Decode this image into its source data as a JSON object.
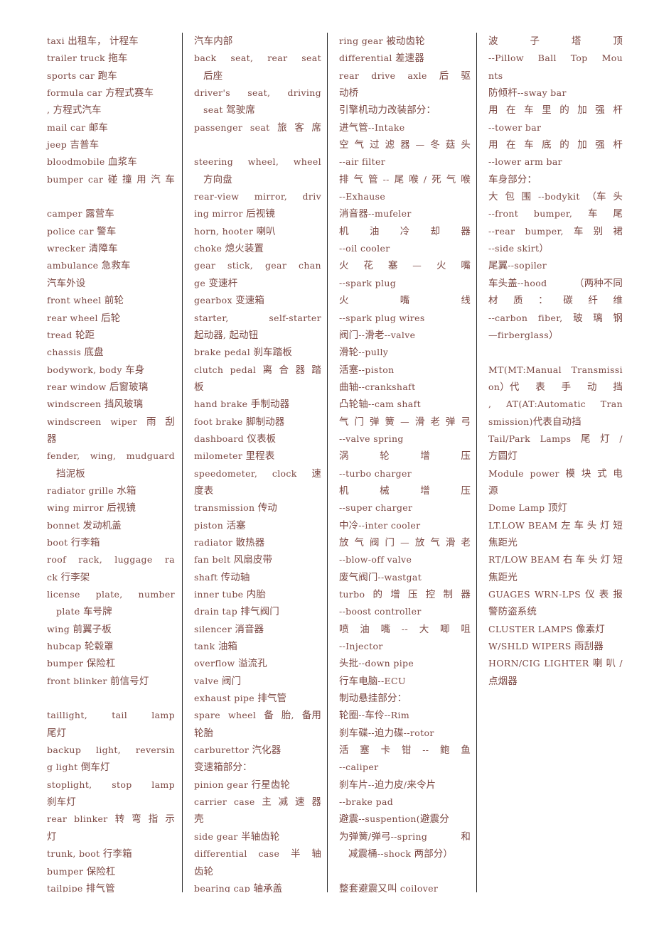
{
  "document": {
    "kind": "car-vocabulary-glossary",
    "language_pair": "English-Chinese",
    "text_color": "#7b4742",
    "rule_color": "#2b2b2b",
    "background": "#ffffff",
    "column_count": 4
  },
  "columns": [
    {
      "name": "column-1",
      "lines": [
        {
          "id": "c1l1",
          "text": "taxi  出租车， 计程车"
        },
        {
          "id": "c1l2",
          "text": "trailer  truck  拖车"
        },
        {
          "id": "c1l3",
          "text": "sports  car  跑车"
        },
        {
          "id": "c1l4",
          "text": "formula  car  方程式赛车"
        },
        {
          "id": "c1l5",
          "text": ",  方程式汽车"
        },
        {
          "id": "c1l6",
          "text": "mail  car  邮车"
        },
        {
          "id": "c1l7",
          "text": "jeep  吉普车"
        },
        {
          "id": "c1l8",
          "text": "bloodmobile  血浆车"
        },
        {
          "id": "c1l9",
          "text": "bumper  car  碰 撞 用 汽 车",
          "justify": true
        },
        {
          "id": "c1l10",
          "text": "",
          "blank": true
        },
        {
          "id": "c1l11",
          "text": "camper  露营车"
        },
        {
          "id": "c1l12",
          "text": "police  car  警车"
        },
        {
          "id": "c1l13",
          "text": "wrecker  清障车"
        },
        {
          "id": "c1l14",
          "text": "ambulance  急救车"
        },
        {
          "id": "c1l15",
          "text": "汽车外设"
        },
        {
          "id": "c1l16",
          "text": "front  wheel  前轮"
        },
        {
          "id": "c1l17",
          "text": "rear  wheel  后轮"
        },
        {
          "id": "c1l18",
          "text": "tread  轮距"
        },
        {
          "id": "c1l19",
          "text": "chassis  底盘"
        },
        {
          "id": "c1l20",
          "text": "bodywork,  body 车身"
        },
        {
          "id": "c1l21",
          "text": "rear  window  后窗玻璃"
        },
        {
          "id": "c1l22",
          "text": "windscreen  挡风玻璃"
        },
        {
          "id": "c1l23",
          "text": "windscreen  wiper  雨  刮",
          "justify": true
        },
        {
          "id": "c1l24",
          "text": "器"
        },
        {
          "id": "c1l25",
          "text": "fender,  wing,  mudguard",
          "justify": true
        },
        {
          "id": "c1l26",
          "text": "挡泥板",
          "indent": true
        },
        {
          "id": "c1l27",
          "text": "radiator  grille  水箱"
        },
        {
          "id": "c1l28",
          "text": "wing  mirror  后视镜"
        },
        {
          "id": "c1l29",
          "text": "bonnet  发动机盖"
        },
        {
          "id": "c1l30",
          "text": "boot  行李箱"
        },
        {
          "id": "c1l31",
          "text": "roof  rack,  luggage  ra",
          "justify": true
        },
        {
          "id": "c1l32",
          "text": "ck  行李架"
        },
        {
          "id": "c1l33",
          "text": "license  plate,  number",
          "justify": true
        },
        {
          "id": "c1l34",
          "text": "plate  车号牌",
          "indent": true
        },
        {
          "id": "c1l35",
          "text": "wing  前翼子板"
        },
        {
          "id": "c1l36",
          "text": "hubcap  轮毂罩"
        },
        {
          "id": "c1l37",
          "text": "bumper  保险杠"
        },
        {
          "id": "c1l38",
          "text": "front  blinker  前信号灯"
        },
        {
          "id": "c1l39",
          "text": "",
          "blank": true
        },
        {
          "id": "c1l40",
          "text": "taillight,  tail  lamp",
          "justify": true
        },
        {
          "id": "c1l41",
          "text": "尾灯"
        },
        {
          "id": "c1l42",
          "text": "backup  light,  reversin",
          "justify": true
        },
        {
          "id": "c1l43",
          "text": "g  light  倒车灯"
        },
        {
          "id": "c1l44",
          "text": "stoplight,  stop  lamp",
          "justify": true
        },
        {
          "id": "c1l45",
          "text": "刹车灯"
        },
        {
          "id": "c1l46",
          "text": "rear  blinker  转 弯 指 示",
          "justify": true
        },
        {
          "id": "c1l47",
          "text": "灯"
        },
        {
          "id": "c1l48",
          "text": "trunk,  boot  行李箱"
        },
        {
          "id": "c1l49",
          "text": "bumper  保险杠"
        },
        {
          "id": "c1l50",
          "text": "tailpipe  排气管"
        }
      ]
    },
    {
      "name": "column-2",
      "lines": [
        {
          "id": "c2l1",
          "text": "汽车内部"
        },
        {
          "id": "c2l2",
          "text": "back  seat,  rear  seat",
          "justify": true
        },
        {
          "id": "c2l3",
          "text": "后座",
          "indent": true
        },
        {
          "id": "c2l4",
          "text": "driver's  seat,  driving",
          "justify": true
        },
        {
          "id": "c2l5",
          "text": "seat  驾驶席",
          "indent": true
        },
        {
          "id": "c2l6",
          "text": "passenger  seat  旅 客 席",
          "justify": true
        },
        {
          "id": "c2l7",
          "text": "",
          "blank": true
        },
        {
          "id": "c2l8",
          "text": "steering  wheel,  wheel",
          "justify": true
        },
        {
          "id": "c2l9",
          "text": "方向盘",
          "indent": true
        },
        {
          "id": "c2l10",
          "text": "rear-view  mirror,  driv",
          "justify": true
        },
        {
          "id": "c2l11",
          "text": "ing  mirror  后视镜"
        },
        {
          "id": "c2l12",
          "text": "horn,  hooter  喇叭"
        },
        {
          "id": "c2l13",
          "text": "choke  熄火装置"
        },
        {
          "id": "c2l14",
          "text": "gear  stick,  gear  chan",
          "justify": true
        },
        {
          "id": "c2l15",
          "text": "ge  变速杆"
        },
        {
          "id": "c2l16",
          "text": "gearbox  变速箱"
        },
        {
          "id": "c2l17",
          "text": "starter,  self-starter",
          "justify": true
        },
        {
          "id": "c2l18",
          "text": "起动器, 起动钮"
        },
        {
          "id": "c2l19",
          "text": "brake  pedal  刹车踏板"
        },
        {
          "id": "c2l20",
          "text": "clutch  pedal  离 合 器 踏",
          "justify": true
        },
        {
          "id": "c2l21",
          "text": "板"
        },
        {
          "id": "c2l22",
          "text": "hand  brake  手制动器"
        },
        {
          "id": "c2l23",
          "text": "foot  brake  脚制动器"
        },
        {
          "id": "c2l24",
          "text": "dashboard  仪表板"
        },
        {
          "id": "c2l25",
          "text": "milometer  里程表"
        },
        {
          "id": "c2l26",
          "text": "speedometer,  clock  速",
          "justify": true
        },
        {
          "id": "c2l27",
          "text": "度表"
        },
        {
          "id": "c2l28",
          "text": "transmission  传动"
        },
        {
          "id": "c2l29",
          "text": "piston  活塞"
        },
        {
          "id": "c2l30",
          "text": "radiator  散热器"
        },
        {
          "id": "c2l31",
          "text": "fan  belt  风扇皮带"
        },
        {
          "id": "c2l32",
          "text": "shaft  传动轴"
        },
        {
          "id": "c2l33",
          "text": "inner  tube  内胎"
        },
        {
          "id": "c2l34",
          "text": "drain  tap  排气阀门"
        },
        {
          "id": "c2l35",
          "text": "silencer  消音器"
        },
        {
          "id": "c2l36",
          "text": "tank  油箱"
        },
        {
          "id": "c2l37",
          "text": "overflow  溢流孔"
        },
        {
          "id": "c2l38",
          "text": "valve  阀门"
        },
        {
          "id": "c2l39",
          "text": "exhaust  pipe  排气管"
        },
        {
          "id": "c2l40",
          "text": "spare  wheel  备 胎, 备用",
          "justify": true
        },
        {
          "id": "c2l41",
          "text": "轮胎"
        },
        {
          "id": "c2l42",
          "text": "carburettor  汽化器"
        },
        {
          "id": "c2l43",
          "text": "变速箱部分："
        },
        {
          "id": "c2l44",
          "text": "pinion  gear  行星齿轮"
        },
        {
          "id": "c2l45",
          "text": "carrier  case  主 减 速 器",
          "justify": true
        },
        {
          "id": "c2l46",
          "text": "壳"
        },
        {
          "id": "c2l47",
          "text": "side  gear  半轴齿轮"
        },
        {
          "id": "c2l48",
          "text": "differential  case  半 轴",
          "justify": true
        },
        {
          "id": "c2l49",
          "text": "齿轮"
        },
        {
          "id": "c2l50",
          "text": "bearing  cap  轴承盖"
        }
      ]
    },
    {
      "name": "column-3",
      "lines": [
        {
          "id": "c3l1",
          "text": "ring  gear  被动齿轮"
        },
        {
          "id": "c3l2",
          "text": "differential  差速器"
        },
        {
          "id": "c3l3",
          "text": "rear  drive  axle  后  驱",
          "justify": true
        },
        {
          "id": "c3l4",
          "text": "动桥"
        },
        {
          "id": "c3l5",
          "text": "引擎机动力改装部分："
        },
        {
          "id": "c3l6",
          "text": "进气管--Intake"
        },
        {
          "id": "c3l7",
          "text": "空 气 过 滤 器 — 冬 菇 头",
          "justify": true
        },
        {
          "id": "c3l8",
          "text": "--air  filter"
        },
        {
          "id": "c3l9",
          "text": "排 气 管 -- 尾 喉 / 死 气 喉",
          "justify": true
        },
        {
          "id": "c3l10",
          "text": "--Exhause"
        },
        {
          "id": "c3l11",
          "text": "消音器--mufeler"
        },
        {
          "id": "c3l12",
          "text": "机  油  冷  却  器",
          "justify": true
        },
        {
          "id": "c3l13",
          "text": "--oil  cooler"
        },
        {
          "id": "c3l14",
          "text": "火  花  塞  —  火  嘴",
          "justify": true
        },
        {
          "id": "c3l15",
          "text": "--spark  plug"
        },
        {
          "id": "c3l16",
          "text": "火  嘴  线",
          "justify": true
        },
        {
          "id": "c3l17",
          "text": "--spark  plug  wires"
        },
        {
          "id": "c3l18",
          "text": "阀门--滑老--valve"
        },
        {
          "id": "c3l19",
          "text": "滑轮--pully"
        },
        {
          "id": "c3l20",
          "text": "活塞--piston"
        },
        {
          "id": "c3l21",
          "text": "曲轴--crankshaft"
        },
        {
          "id": "c3l22",
          "text": "凸轮轴--cam  shaft"
        },
        {
          "id": "c3l23",
          "text": "气 门 弹 簧 — 滑 老 弹 弓",
          "justify": true
        },
        {
          "id": "c3l24",
          "text": "--valve  spring"
        },
        {
          "id": "c3l25",
          "text": "涡  轮  增  压",
          "justify": true
        },
        {
          "id": "c3l26",
          "text": "--turbo  charger"
        },
        {
          "id": "c3l27",
          "text": "机  械  增  压",
          "justify": true
        },
        {
          "id": "c3l28",
          "text": "--super  charger"
        },
        {
          "id": "c3l29",
          "text": "中冷--inter  cooler"
        },
        {
          "id": "c3l30",
          "text": "放 气 阀 门 — 放 气 滑 老",
          "justify": true
        },
        {
          "id": "c3l31",
          "text": "--blow-off  valve"
        },
        {
          "id": "c3l32",
          "text": "废气阀门--wastgat"
        },
        {
          "id": "c3l33",
          "text": "turbo 的 增 压 控 制 器",
          "justify": true
        },
        {
          "id": "c3l34",
          "text": "--boost  controller"
        },
        {
          "id": "c3l35",
          "text": "喷 油 嘴 -- 大 唧 咀",
          "justify": true
        },
        {
          "id": "c3l36",
          "text": "--Injector"
        },
        {
          "id": "c3l37",
          "text": "头批--down  pipe"
        },
        {
          "id": "c3l38",
          "text": "行车电脑--ECU"
        },
        {
          "id": "c3l39",
          "text": "制动悬挂部分："
        },
        {
          "id": "c3l40",
          "text": "轮圈--车伶--Rim"
        },
        {
          "id": "c3l41",
          "text": "刹车碟--迫力碟--rotor"
        },
        {
          "id": "c3l42",
          "text": "活 塞 卡 钳 -- 鲍 鱼",
          "justify": true
        },
        {
          "id": "c3l43",
          "text": "--caliper"
        },
        {
          "id": "c3l44",
          "text": "刹车片--迫力皮/来令片",
          "justify": true
        },
        {
          "id": "c3l45",
          "text": "--brake  pad"
        },
        {
          "id": "c3l46",
          "text": "避震--suspention(避震分",
          "justify": true
        },
        {
          "id": "c3l47",
          "text": "为弹簧/弹弓--spring  和",
          "justify": true
        },
        {
          "id": "c3l48",
          "text": "减震桶--shock  两部分）",
          "indent": true
        },
        {
          "id": "c3l49",
          "text": "",
          "blank": true
        },
        {
          "id": "c3l50",
          "text": "整套避震又叫  coilover"
        }
      ]
    },
    {
      "name": "column-4",
      "lines": [
        {
          "id": "c4l1",
          "text": "波  子  塔  顶",
          "justify": true
        },
        {
          "id": "c4l2",
          "text": "--Pillow  Ball  Top  Mou",
          "justify": true
        },
        {
          "id": "c4l3",
          "text": "nts"
        },
        {
          "id": "c4l4",
          "text": "防倾杆--sway  bar"
        },
        {
          "id": "c4l5",
          "text": "用 在 车 里 的 加 强 杆",
          "justify": true
        },
        {
          "id": "c4l6",
          "text": "--tower  bar"
        },
        {
          "id": "c4l7",
          "text": "用 在 车 底 的 加 强 杆",
          "justify": true
        },
        {
          "id": "c4l8",
          "text": "--lower  arm  bar"
        },
        {
          "id": "c4l9",
          "text": "车身部分："
        },
        {
          "id": "c4l10",
          "text": "大 包 围 --bodykit （车 头",
          "justify": true
        },
        {
          "id": "c4l11",
          "text": "--front  bumper,  车  尾",
          "justify": true
        },
        {
          "id": "c4l12",
          "text": "--rear  bumper,  车 别 裙",
          "justify": true
        },
        {
          "id": "c4l13",
          "text": "--side  skirt）"
        },
        {
          "id": "c4l14",
          "text": "尾翼--sopiler"
        },
        {
          "id": "c4l15",
          "text": "车头盖--hood  （两种不同",
          "justify": true
        },
        {
          "id": "c4l16",
          "text": "材 质 ： 碳 纤 维",
          "justify": true
        },
        {
          "id": "c4l17",
          "text": "--carbon  fiber,  玻 璃 钢",
          "justify": true
        },
        {
          "id": "c4l18",
          "text": "—firberglass）"
        },
        {
          "id": "c4l19",
          "text": "",
          "blank": true
        },
        {
          "id": "c4l20",
          "text": "MT(MT:Manual  Transmissi",
          "justify": true
        },
        {
          "id": "c4l21",
          "text": "on）代 表 手 动 挡",
          "justify": true
        },
        {
          "id": "c4l22",
          "text": ",  AT(AT:Automatic  Tran",
          "justify": true
        },
        {
          "id": "c4l23",
          "text": "smission)代表自动挡"
        },
        {
          "id": "c4l24",
          "text": "Tail/Park  Lamps  尾 灯 /",
          "justify": true
        },
        {
          "id": "c4l25",
          "text": "方圆灯"
        },
        {
          "id": "c4l26",
          "text": "Module  power  模 块 式 电",
          "justify": true
        },
        {
          "id": "c4l27",
          "text": "源"
        },
        {
          "id": "c4l28",
          "text": "Dome  Lamp  顶灯"
        },
        {
          "id": "c4l29",
          "text": "LT.LOW  BEAM  左 车 头 灯 短",
          "justify": true
        },
        {
          "id": "c4l30",
          "text": "焦距光"
        },
        {
          "id": "c4l31",
          "text": "RT/LOW  BEAM  右 车 头 灯 短",
          "justify": true
        },
        {
          "id": "c4l32",
          "text": "焦距光"
        },
        {
          "id": "c4l33",
          "text": "GUAGES  WRN-LPS  仪 表 报",
          "justify": true
        },
        {
          "id": "c4l34",
          "text": "警防盗系统"
        },
        {
          "id": "c4l35",
          "text": "CLUSTER  LAMPS  像素灯"
        },
        {
          "id": "c4l36",
          "text": "W/SHLD  WIPERS  雨刮器"
        },
        {
          "id": "c4l37",
          "text": "HORN/CIG  LIGHTER  喇 叭 /",
          "justify": true
        },
        {
          "id": "c4l38",
          "text": "点烟器"
        }
      ]
    }
  ]
}
